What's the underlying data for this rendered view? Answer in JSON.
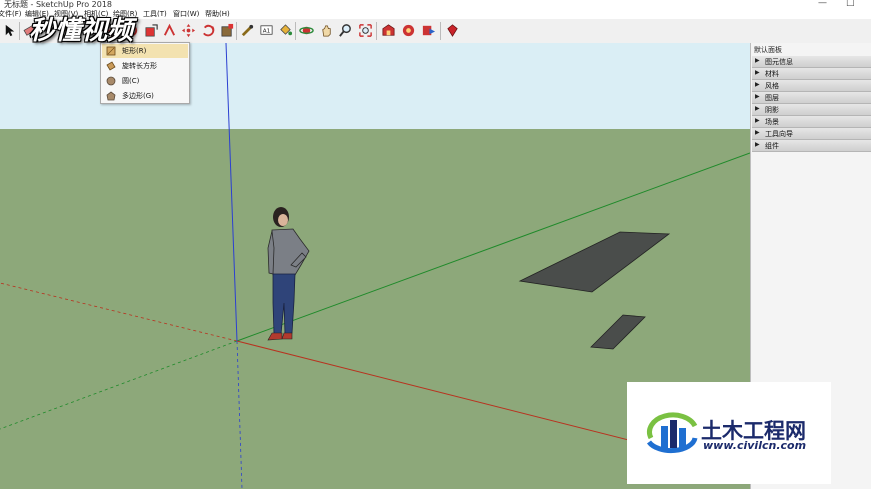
{
  "window": {
    "title": "无标题 - SketchUp Pro 2018",
    "minimize_glyph": "—",
    "maximize_glyph": "□"
  },
  "menu": {
    "items": [
      "文件(F)",
      "编辑(E)",
      "视图(V)",
      "相机(C)",
      "绘图(R)",
      "工具(T)",
      "窗口(W)",
      "帮助(H)"
    ]
  },
  "toolbar": {
    "tools": [
      {
        "name": "select-tool-icon"
      },
      {
        "name": "eraser-tool-icon"
      },
      {
        "name": "line-tool-icon"
      },
      {
        "name": "shapes-tool-icon"
      },
      {
        "name": "push-pull-tool-icon"
      },
      {
        "name": "move-tool-icon"
      },
      {
        "name": "rotate-tool-icon"
      },
      {
        "name": "scale-tool-icon"
      },
      {
        "name": "tape-measure-icon"
      },
      {
        "name": "text-tool-icon"
      },
      {
        "name": "paint-bucket-icon"
      },
      {
        "name": "orbit-tool-icon"
      },
      {
        "name": "pan-tool-icon"
      },
      {
        "name": "zoom-tool-icon"
      },
      {
        "name": "zoom-extents-icon"
      },
      {
        "name": "3d-warehouse-icon"
      },
      {
        "name": "extension-warehouse-icon"
      },
      {
        "name": "share-model-icon"
      },
      {
        "name": "ruby-console-icon"
      }
    ],
    "text_tool_label": "A1"
  },
  "shapes_dropdown": {
    "items": [
      {
        "label": "矩形(R)",
        "icon": "rectangle-icon",
        "selected": true
      },
      {
        "label": "旋转长方形",
        "icon": "rotated-rectangle-icon",
        "selected": false
      },
      {
        "label": "圆(C)",
        "icon": "circle-icon",
        "selected": false
      },
      {
        "label": "多边形(G)",
        "icon": "polygon-icon",
        "selected": false
      }
    ]
  },
  "tray": {
    "title": "默认面板",
    "sections": [
      "图元信息",
      "材料",
      "风格",
      "图层",
      "阴影",
      "场景",
      "工具向导",
      "组件"
    ]
  },
  "watermarks": {
    "video_logo": "秒懂视频",
    "site_name": "土木工程网",
    "site_url": "www.civilcn.com"
  },
  "colors": {
    "sky": "#daeef5",
    "ground": "#8da87a",
    "red_axis": "#b8321f",
    "green_axis": "#1f8a2a",
    "blue_axis": "#2b3fd1",
    "face": "#4a4d4b",
    "brand_blue": "#1b2a6b",
    "menu_highlight": "#f3e2b0"
  }
}
